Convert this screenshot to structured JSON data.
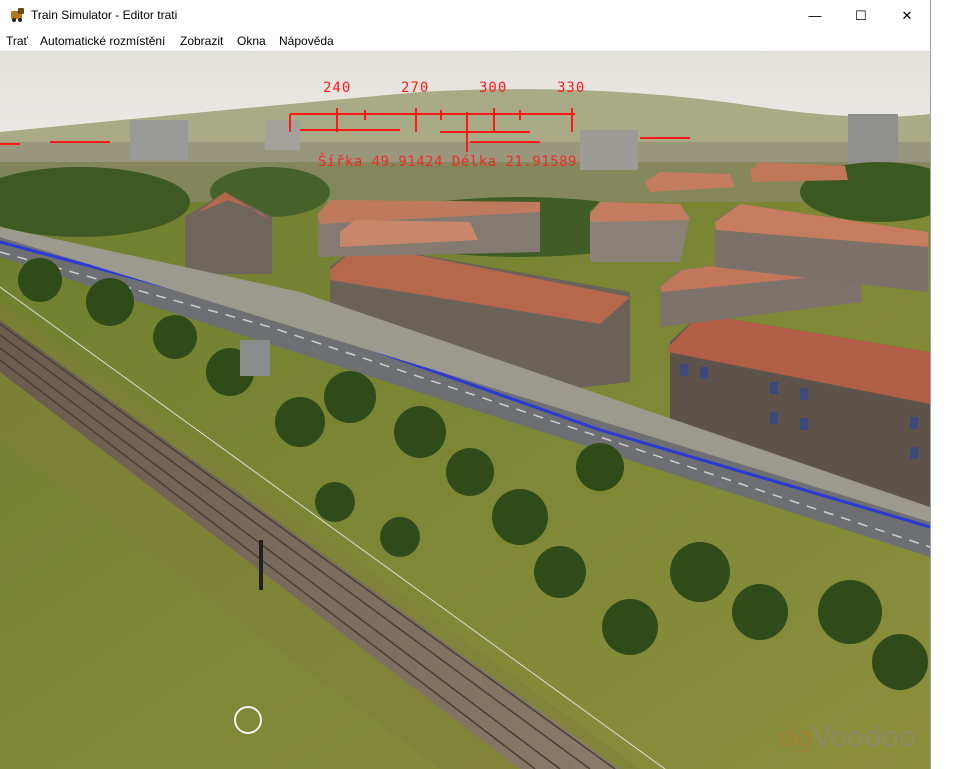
{
  "window": {
    "title": "Train Simulator - Editor trati",
    "icon": "train-app-icon",
    "controls": {
      "minimize": "—",
      "maximize": "☐",
      "close": "✕"
    }
  },
  "menu": {
    "items": [
      "Trať",
      "Automatické rozmístění",
      "Zobrazit",
      "Okna",
      "Nápověda"
    ]
  },
  "hud": {
    "heading_ticks": [
      "240",
      "270",
      "300",
      "330"
    ],
    "coordinates": "Šířka 49.91424 Délka 21.91589",
    "color": "#ff1a1a"
  },
  "watermark": {
    "prefix": "dg",
    "suffix": "Voodoo"
  },
  "scene": {
    "sky_color": "#e9e7e2",
    "grass_color": "#7a8a3a",
    "roof_color": "#b8684c",
    "rail_color": "#7a6a5a"
  }
}
